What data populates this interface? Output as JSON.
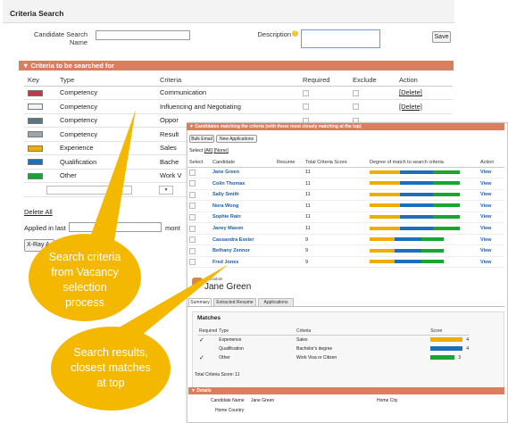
{
  "page_title": "Criteria Search",
  "form": {
    "candidate_search_name_label_1": "Candidate Search",
    "candidate_search_name_label_2": "Name",
    "description_label": "Description",
    "save_label": "Save"
  },
  "criteria_section": {
    "title": "▼ Criteria to be searched for",
    "headers": {
      "key": "Key",
      "type": "Type",
      "criteria": "Criteria",
      "required": "Required",
      "exclude": "Exclude",
      "action": "Action"
    },
    "rows": [
      {
        "color": "#c0394a",
        "type": "Competency",
        "criteria": "Communication",
        "action": "[Delete]"
      },
      {
        "color": "#eef3f8",
        "type": "Competency",
        "criteria": "Influencing and Negotiating",
        "action": "[Delete]"
      },
      {
        "color": "#5e7582",
        "type": "Competency",
        "criteria": "Oppor",
        "action": ""
      },
      {
        "color": "#9aa6ab",
        "type": "Competency",
        "criteria": "Result",
        "action": ""
      },
      {
        "color": "#f0ad00",
        "type": "Experience",
        "criteria": "Sales",
        "action": ""
      },
      {
        "color": "#1c6fba",
        "type": "Qualification",
        "criteria": "Bache",
        "action": ""
      },
      {
        "color": "#16a631",
        "type": "Other",
        "criteria": "Work V",
        "action": ""
      }
    ],
    "select_arrow": "▼",
    "delete_all": "Delete All",
    "applied_in_last": "Applied in last",
    "months_partial": "mont",
    "xray_partial": "X-Ray A"
  },
  "results": {
    "title": "▼ Candidates matching the criteria (with those most closely matching at the top)",
    "bulk_email": "Bulk Email",
    "new_applications": "New Applications",
    "select_text": "Select",
    "select_all": "All",
    "select_none": "None",
    "headers": {
      "select": "Select",
      "candidate": "Candidate",
      "resume": "Resume",
      "score": "Total Criteria Score",
      "degree": "Degree of match to search criteria",
      "action": "Action"
    },
    "rows": [
      {
        "name": "Jane Green",
        "score": "11",
        "action": "View",
        "match": [
          0.3,
          0.33,
          0.27
        ]
      },
      {
        "name": "Colin Thomas",
        "score": "11",
        "action": "View",
        "match": [
          0.3,
          0.33,
          0.27
        ]
      },
      {
        "name": "Sally Smith",
        "score": "11",
        "action": "View",
        "match": [
          0.3,
          0.33,
          0.27
        ]
      },
      {
        "name": "Nora Wong",
        "score": "11",
        "action": "View",
        "match": [
          0.3,
          0.33,
          0.27
        ]
      },
      {
        "name": "Sophie Rain",
        "score": "11",
        "action": "View",
        "match": [
          0.3,
          0.33,
          0.27
        ]
      },
      {
        "name": "Janey Mason",
        "score": "11",
        "action": "View",
        "match": [
          0.3,
          0.33,
          0.27
        ]
      },
      {
        "name": "Cassandra Exeter",
        "score": "9",
        "action": "View",
        "match": [
          0.25,
          0.27,
          0.22
        ]
      },
      {
        "name": "Bethany Zennor",
        "score": "9",
        "action": "View",
        "match": [
          0.25,
          0.27,
          0.22
        ]
      },
      {
        "name": "Fred Jones",
        "score": "9",
        "action": "View",
        "match": [
          0.25,
          0.27,
          0.22
        ]
      }
    ]
  },
  "candidate": {
    "label": "Candidate",
    "name": "Jane Green",
    "tabs": [
      "Summary",
      "Extracted Resume",
      "Applications"
    ],
    "matches_title": "Matches",
    "matches_headers": {
      "required": "Required",
      "type": "Type",
      "criteria": "Criteria",
      "score": "Score"
    },
    "matches": [
      {
        "required": "✓",
        "type": "Experience",
        "criteria": "Sales",
        "score": "4",
        "color": "#f0ad00",
        "level": 1.0
      },
      {
        "required": "",
        "type": "Qualification",
        "criteria": "Bachelor's degree",
        "score": "4",
        "color": "#1c6fba",
        "level": 1.0
      },
      {
        "required": "✓",
        "type": "Other",
        "criteria": "Work Visa or Citizen",
        "score": "3",
        "color": "#16a631",
        "level": 0.75
      }
    ],
    "total_score_label": "Total Criteria Score:",
    "total_score": "11",
    "details_title": "▼ Details",
    "candidate_name_label": "Candidate Name",
    "candidate_name_value": "Jane Green",
    "home_city_label": "Home City",
    "home_country_label": "Home Country"
  },
  "callouts": {
    "criteria": [
      "Search criteria",
      "from Vacancy",
      "selection",
      "process"
    ],
    "results": [
      "Search results,",
      "closest matches",
      "at top"
    ]
  },
  "colors": {
    "orange_bar": "#d97e5e",
    "callout": "#f5b800",
    "link": "#1c5fa8"
  }
}
